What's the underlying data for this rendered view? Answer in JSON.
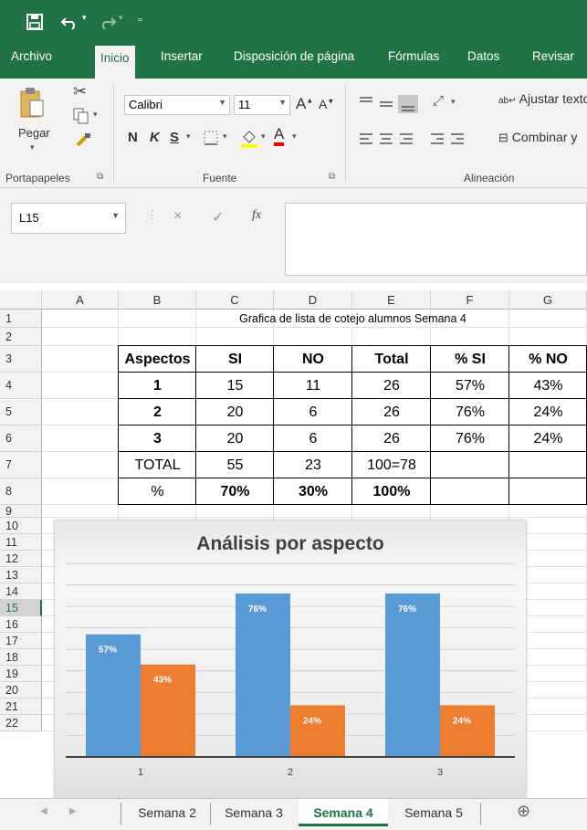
{
  "quick_access": {
    "save_icon": "save-icon",
    "undo_icon": "undo-icon",
    "redo_icon": "redo-icon",
    "customize_icon": "customize-icon"
  },
  "tabs": [
    "Archivo",
    "Inicio",
    "Insertar",
    "Disposición de página",
    "Fórmulas",
    "Datos",
    "Revisar"
  ],
  "ribbon": {
    "clipboard": {
      "paste_label": "Pegar",
      "group_label": "Portapapeles"
    },
    "font": {
      "font_name": "Calibri",
      "font_size": "11",
      "bold": "N",
      "italic": "K",
      "underline": "S",
      "grow": "A",
      "shrink": "A",
      "font_color_letter": "A",
      "group_label": "Fuente"
    },
    "alignment": {
      "wrap_text": "Ajustar texto",
      "merge": "Combinar y",
      "group_label": "Alineación"
    }
  },
  "formula_bar": {
    "name_box": "L15",
    "cancel": "×",
    "enter": "✓",
    "fx": "fx",
    "formula": ""
  },
  "columns": [
    "A",
    "B",
    "C",
    "D",
    "E",
    "F",
    "G"
  ],
  "rows": [
    "1",
    "2",
    "3",
    "4",
    "5",
    "6",
    "7",
    "8",
    "9",
    "10",
    "11",
    "12",
    "13",
    "14",
    "15",
    "16",
    "17",
    "18",
    "19",
    "20",
    "21",
    "22"
  ],
  "sheet": {
    "title": "Grafica de lista de cotejo alumnos Semana 4",
    "headers": [
      "Aspectos",
      "SI",
      "NO",
      "Total",
      "% SI",
      "% NO"
    ],
    "data_rows": [
      [
        "1",
        "15",
        "11",
        "26",
        "57%",
        "43%"
      ],
      [
        "2",
        "20",
        "6",
        "26",
        "76%",
        "24%"
      ],
      [
        "3",
        "20",
        "6",
        "26",
        "76%",
        "24%"
      ]
    ],
    "total_row": [
      "TOTAL",
      "55",
      "23",
      "100=78",
      "",
      ""
    ],
    "pct_row": [
      "%",
      "70%",
      "30%",
      "100%",
      "",
      ""
    ]
  },
  "chart_data": {
    "type": "bar",
    "title": "Análisis por aspecto",
    "categories": [
      "1",
      "2",
      "3"
    ],
    "series": [
      {
        "values": [
          57,
          76,
          76
        ],
        "labels": [
          "57%",
          "76%",
          "76%"
        ],
        "color": "#5b9bd5"
      },
      {
        "values": [
          43,
          24,
          24
        ],
        "labels": [
          "43%",
          "24%",
          "24%"
        ],
        "color": "#ed7d31"
      }
    ],
    "ylim": [
      0,
      90
    ],
    "grid": true,
    "xlabel": "",
    "ylabel": ""
  },
  "sheet_tabs": [
    "Semana 2",
    "Semana 3",
    "Semana 4",
    "Semana 5"
  ],
  "active_sheet": "Semana 4",
  "colors": {
    "excel_green": "#217346",
    "bar_blue": "#5b9bd5",
    "bar_orange": "#ed7d31"
  }
}
